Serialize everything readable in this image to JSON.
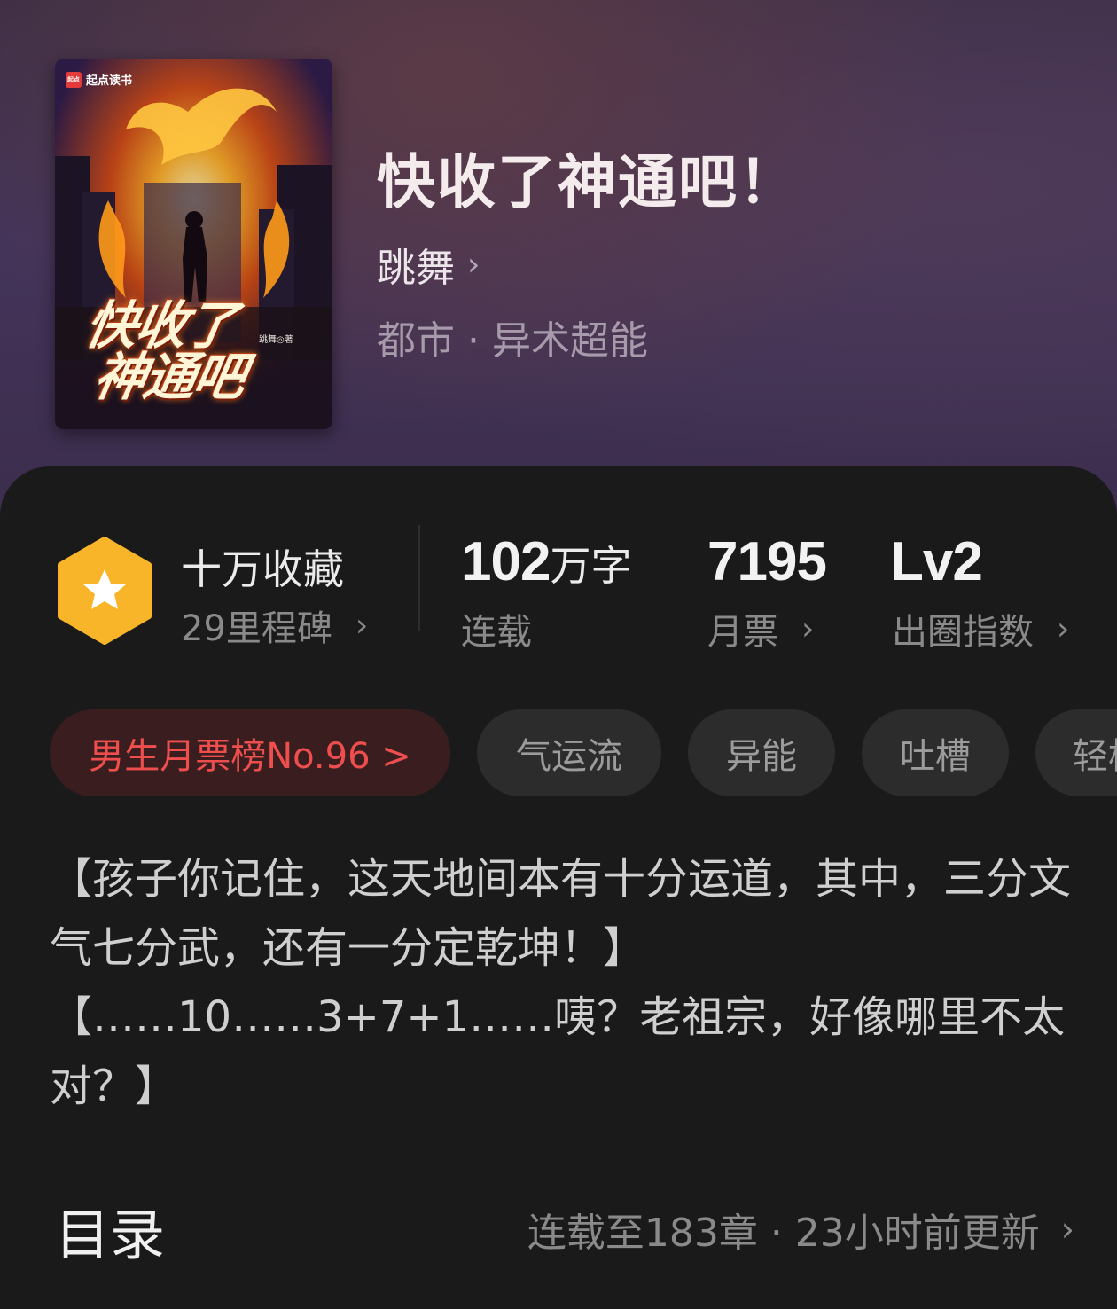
{
  "cover": {
    "brand": "起点读书",
    "brand_logo": "起点",
    "title_line1": "快收了",
    "title_line2": "神通吧",
    "author_mark": "跳舞◎著"
  },
  "book": {
    "title": "快收了神通吧！",
    "author": "跳舞",
    "genre": "都市 · 异术超能"
  },
  "stats": {
    "collection_label": "十万收藏",
    "milestone_label": "29里程碑",
    "word_count_number": "102",
    "word_count_unit": "万字",
    "status_label": "连载",
    "monthly_votes": "7195",
    "monthly_votes_label": "月票",
    "level": "Lv2",
    "breakout_label": "出圈指数"
  },
  "tags": {
    "rank": "男生月票榜No.96 >",
    "items": [
      "气运流",
      "异能",
      "吐槽",
      "轻松"
    ]
  },
  "synopsis": {
    "para1": "【孩子你记住，这天地间本有十分运道，其中，三分文气七分武，还有一分定乾坤！】",
    "para2": "【……10……3+7+1……咦？老祖宗，好像哪里不太对？】"
  },
  "toc": {
    "title": "目录",
    "info": "连载至183章 · 23小时前更新"
  },
  "colors": {
    "accent_red": "#ef4e4e",
    "badge_yellow": "#f9b52a",
    "panel_bg": "#1a1a1a"
  },
  "icons": [
    "star-hexagon-icon",
    "chevron-right-icon"
  ]
}
